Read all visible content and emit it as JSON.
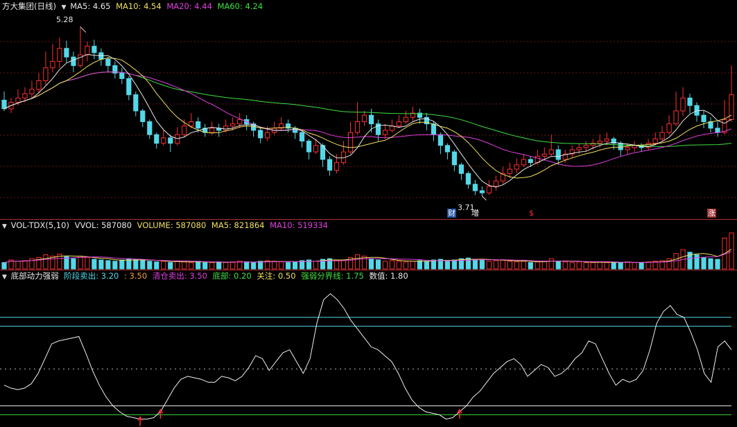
{
  "price_legend": {
    "title": "方大集团(日线)",
    "ma5": "MA5: 4.65",
    "ma10": "MA10: 4.54",
    "ma20": "MA20: 4.44",
    "ma60": "MA60: 4.24"
  },
  "annotations": {
    "high": "5.28",
    "low": "3.71",
    "tag_cai": "财",
    "tag_zeng": "增",
    "tag_dollar": "$",
    "tag_zhang": "涨"
  },
  "volume_legend": {
    "title": "VOL-TDX(5,10)",
    "vvol": "VVOL: 587080",
    "volume": "VOLUME: 587080",
    "ma5": "MA5: 821864",
    "ma10": "MA10: 519334"
  },
  "indicator_legend": {
    "title": "底部动力强弱",
    "stage_sell": "阶段卖出: 3.20",
    "stage_sell_2": ": 3.50",
    "clear_sell": "清仓卖出: 3.50",
    "bottom": "底部: 0.20",
    "focus": "关注: 0.50",
    "strength_line": "强弱分界线: 1.75",
    "value": "数值: 1.80"
  },
  "colors": {
    "up": "#ff3030",
    "down": "#54d8e8",
    "ma5": "#e8e8e8",
    "ma10": "#f0e060",
    "ma20": "#e040e0",
    "ma60": "#40e040",
    "separator": "#b0302e"
  },
  "chart_data": {
    "type": "candlestick",
    "candles": [
      [
        4.6,
        4.52,
        4.68,
        4.5
      ],
      [
        4.52,
        4.58,
        4.62,
        4.48
      ],
      [
        4.58,
        4.62,
        4.7,
        4.55
      ],
      [
        4.62,
        4.66,
        4.72,
        4.58
      ],
      [
        4.66,
        4.7,
        4.78,
        4.62
      ],
      [
        4.7,
        4.78,
        4.85,
        4.66
      ],
      [
        4.78,
        4.9,
        5.05,
        4.74
      ],
      [
        4.9,
        4.96,
        5.12,
        4.86
      ],
      [
        4.96,
        5.08,
        5.18,
        4.9
      ],
      [
        5.08,
        5.0,
        5.15,
        4.95
      ],
      [
        5.0,
        4.92,
        5.05,
        4.86
      ],
      [
        4.92,
        5.02,
        5.28,
        4.9
      ],
      [
        5.02,
        5.1,
        5.14,
        4.96
      ],
      [
        5.1,
        5.04,
        5.16,
        4.98
      ],
      [
        5.04,
        4.98,
        5.08,
        4.92
      ],
      [
        4.98,
        4.92,
        5.0,
        4.86
      ],
      [
        4.92,
        4.85,
        4.96,
        4.8
      ],
      [
        4.85,
        4.8,
        4.9,
        4.75
      ],
      [
        4.8,
        4.65,
        4.82,
        4.6
      ],
      [
        4.65,
        4.5,
        4.68,
        4.45
      ],
      [
        4.5,
        4.4,
        4.52,
        4.35
      ],
      [
        4.4,
        4.28,
        4.42,
        4.24
      ],
      [
        4.28,
        4.2,
        4.3,
        4.15
      ],
      [
        4.2,
        4.25,
        4.32,
        4.18
      ],
      [
        4.25,
        4.2,
        4.28,
        4.12
      ],
      [
        4.2,
        4.28,
        4.35,
        4.18
      ],
      [
        4.28,
        4.36,
        4.42,
        4.26
      ],
      [
        4.36,
        4.4,
        4.48,
        4.34
      ],
      [
        4.4,
        4.34,
        4.44,
        4.3
      ],
      [
        4.34,
        4.3,
        4.38,
        4.26
      ],
      [
        4.3,
        4.34,
        4.4,
        4.28
      ],
      [
        4.34,
        4.32,
        4.38,
        4.26
      ],
      [
        4.32,
        4.36,
        4.42,
        4.3
      ],
      [
        4.36,
        4.38,
        4.44,
        4.32
      ],
      [
        4.38,
        4.42,
        4.48,
        4.34
      ],
      [
        4.42,
        4.38,
        4.46,
        4.32
      ],
      [
        4.38,
        4.32,
        4.4,
        4.26
      ],
      [
        4.32,
        4.25,
        4.34,
        4.2
      ],
      [
        4.25,
        4.3,
        4.36,
        4.22
      ],
      [
        4.3,
        4.34,
        4.4,
        4.28
      ],
      [
        4.34,
        4.38,
        4.44,
        4.32
      ],
      [
        4.38,
        4.34,
        4.42,
        4.3
      ],
      [
        4.34,
        4.3,
        4.36,
        4.24
      ],
      [
        4.3,
        4.22,
        4.32,
        4.16
      ],
      [
        4.22,
        4.12,
        4.24,
        4.05
      ],
      [
        4.12,
        4.18,
        4.24,
        4.1
      ],
      [
        4.18,
        4.05,
        4.2,
        3.98
      ],
      [
        4.05,
        3.95,
        4.08,
        3.9
      ],
      [
        3.95,
        4.02,
        4.1,
        3.92
      ],
      [
        4.02,
        4.12,
        4.22,
        4.0
      ],
      [
        4.12,
        4.3,
        4.4,
        4.1
      ],
      [
        4.3,
        4.4,
        4.58,
        4.28
      ],
      [
        4.4,
        4.46,
        4.5,
        4.36
      ],
      [
        4.46,
        4.38,
        4.52,
        4.3
      ],
      [
        4.38,
        4.28,
        4.42,
        4.22
      ],
      [
        4.28,
        4.32,
        4.38,
        4.24
      ],
      [
        4.32,
        4.36,
        4.42,
        4.3
      ],
      [
        4.36,
        4.4,
        4.46,
        4.34
      ],
      [
        4.4,
        4.44,
        4.5,
        4.38
      ],
      [
        4.44,
        4.48,
        4.54,
        4.4
      ],
      [
        4.48,
        4.44,
        4.52,
        4.38
      ],
      [
        4.44,
        4.38,
        4.48,
        4.32
      ],
      [
        4.38,
        4.28,
        4.4,
        4.22
      ],
      [
        4.28,
        4.18,
        4.3,
        4.1
      ],
      [
        4.18,
        4.12,
        4.2,
        4.05
      ],
      [
        4.12,
        4.0,
        4.14,
        3.94
      ],
      [
        4.0,
        3.92,
        4.02,
        3.86
      ],
      [
        3.92,
        3.82,
        3.94,
        3.78
      ],
      [
        3.82,
        3.76,
        3.86,
        3.72
      ],
      [
        3.76,
        3.74,
        3.8,
        3.71
      ],
      [
        3.74,
        3.8,
        3.86,
        3.72
      ],
      [
        3.8,
        3.85,
        3.9,
        3.76
      ],
      [
        3.85,
        3.92,
        3.98,
        3.82
      ],
      [
        3.92,
        3.96,
        4.02,
        3.88
      ],
      [
        3.96,
        4.0,
        4.06,
        3.92
      ],
      [
        4.0,
        4.05,
        4.1,
        3.98
      ],
      [
        4.05,
        4.02,
        4.08,
        3.98
      ],
      [
        4.02,
        4.08,
        4.14,
        4.0
      ],
      [
        4.08,
        4.1,
        4.16,
        4.04
      ],
      [
        4.1,
        4.14,
        4.28,
        4.08
      ],
      [
        4.14,
        4.05,
        4.18,
        4.0
      ],
      [
        4.05,
        4.1,
        4.14,
        4.02
      ],
      [
        4.1,
        4.14,
        4.18,
        4.06
      ],
      [
        4.14,
        4.16,
        4.2,
        4.1
      ],
      [
        4.16,
        4.18,
        4.22,
        4.12
      ],
      [
        4.18,
        4.2,
        4.24,
        4.14
      ],
      [
        4.2,
        4.22,
        4.28,
        4.16
      ],
      [
        4.22,
        4.24,
        4.3,
        4.18
      ],
      [
        4.24,
        4.2,
        4.26,
        4.14
      ],
      [
        4.2,
        4.14,
        4.22,
        4.08
      ],
      [
        4.14,
        4.16,
        4.2,
        4.1
      ],
      [
        4.16,
        4.18,
        4.22,
        4.12
      ],
      [
        4.18,
        4.16,
        4.2,
        4.12
      ],
      [
        4.16,
        4.2,
        4.24,
        4.14
      ],
      [
        4.2,
        4.24,
        4.3,
        4.18
      ],
      [
        4.24,
        4.3,
        4.36,
        4.22
      ],
      [
        4.3,
        4.38,
        4.46,
        4.28
      ],
      [
        4.38,
        4.5,
        4.68,
        4.36
      ],
      [
        4.5,
        4.62,
        4.72,
        4.45
      ],
      [
        4.62,
        4.55,
        4.66,
        4.48
      ],
      [
        4.55,
        4.46,
        4.58,
        4.4
      ],
      [
        4.46,
        4.4,
        4.5,
        4.34
      ],
      [
        4.4,
        4.34,
        4.44,
        4.3
      ],
      [
        4.34,
        4.3,
        4.4,
        4.26
      ],
      [
        4.3,
        4.42,
        4.6,
        4.28
      ],
      [
        4.42,
        4.65,
        4.92,
        4.4
      ]
    ],
    "price_range": [
      3.6,
      5.4
    ],
    "labels": {
      "max": 5.28,
      "min": 3.71
    }
  },
  "volume_data": [
    1,
    1.4,
    1.2,
    1.3,
    1.6,
    1.8,
    2.2,
    2.0,
    2.3,
    1.9,
    1.6,
    2.0,
    1.8,
    1.5,
    1.4,
    1.3,
    1.2,
    1.4,
    1.6,
    1.5,
    1.3,
    1.2,
    1.1,
    1.2,
    1.0,
    1.2,
    1.1,
    1.0,
    1.2,
    1.0,
    1.0,
    1.1,
    1.0,
    1.1,
    1.2,
    1.1,
    1.0,
    1.2,
    1.3,
    1.2,
    1.1,
    1.0,
    1.1,
    1.3,
    1.4,
    1.2,
    1.5,
    1.6,
    1.3,
    1.4,
    1.8,
    2.2,
    2.0,
    1.6,
    1.4,
    1.2,
    1.3,
    1.2,
    1.1,
    1.2,
    1.3,
    1.2,
    1.4,
    1.5,
    1.3,
    1.4,
    1.6,
    1.7,
    1.5,
    1.4,
    1.2,
    1.3,
    1.4,
    1.2,
    1.1,
    1.2,
    1.0,
    1.1,
    1.2,
    1.6,
    1.2,
    1.1,
    1.0,
    1.1,
    1.0,
    1.0,
    1.1,
    1.0,
    1.0,
    1.0,
    1.1,
    1.0,
    1.0,
    1.1,
    1.2,
    1.3,
    1.6,
    2.4,
    3.0,
    2.6,
    2.2,
    1.8,
    1.6,
    1.5,
    4.8,
    5.6
  ],
  "indicator_data": [
    1.2,
    1.1,
    1.05,
    1.1,
    1.25,
    1.6,
    2.1,
    2.6,
    2.7,
    2.75,
    2.8,
    2.85,
    2.3,
    1.7,
    1.2,
    0.8,
    0.5,
    0.3,
    0.15,
    0.1,
    0.05,
    0.05,
    0.1,
    0.3,
    0.7,
    1.1,
    1.4,
    1.5,
    1.45,
    1.4,
    1.3,
    1.3,
    1.5,
    1.45,
    1.35,
    1.5,
    1.8,
    2.2,
    2.1,
    1.7,
    2.0,
    2.3,
    2.4,
    2.0,
    1.6,
    2.1,
    3.3,
    4.1,
    4.3,
    4.1,
    3.8,
    3.4,
    3.1,
    2.8,
    2.5,
    2.4,
    2.2,
    2.0,
    1.6,
    1.1,
    0.7,
    0.45,
    0.3,
    0.25,
    0.2,
    0.05,
    0.1,
    0.3,
    0.5,
    0.8,
    1.0,
    1.3,
    1.6,
    1.8,
    2.0,
    2.1,
    1.9,
    1.5,
    1.7,
    1.9,
    1.8,
    1.5,
    1.6,
    1.8,
    2.1,
    2.3,
    2.7,
    2.6,
    2.1,
    1.6,
    1.2,
    1.4,
    1.3,
    1.4,
    1.7,
    2.4,
    3.3,
    3.7,
    3.9,
    3.6,
    3.5,
    3.0,
    2.4,
    1.6,
    1.3,
    2.5,
    2.7,
    2.4
  ],
  "indicator_levels": {
    "stage_sell": 3.2,
    "clear_sell": 3.5,
    "bottom": 0.2,
    "focus": 0.5,
    "strength": 1.75,
    "range": [
      -0.1,
      4.6
    ]
  }
}
